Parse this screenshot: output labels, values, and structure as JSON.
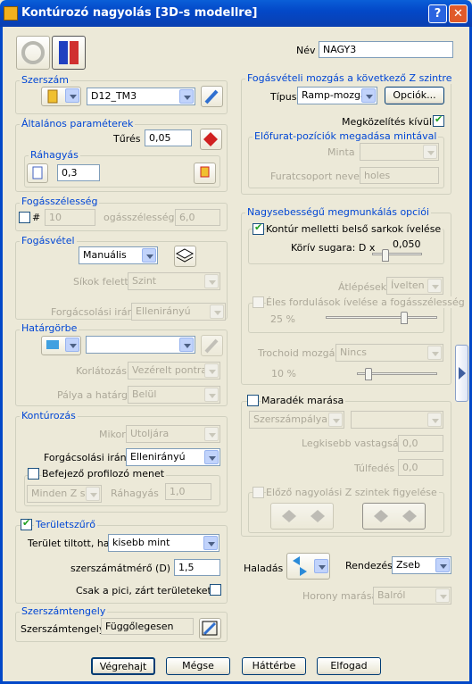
{
  "window": {
    "title": "Kontúrozó nagyolás [3D-s modellre]",
    "help": "?",
    "close": "✕"
  },
  "nev": {
    "label": "Név",
    "value": "NAGY3"
  },
  "szerszam": {
    "legend": "Szerszám",
    "tool": "D12_TM3"
  },
  "altalanos": {
    "legend": "Általános paraméterek",
    "tures_label": "Tűrés",
    "tures": "0,05",
    "rahagyas_legend": "Ráhagyás",
    "rahagyas": "0,3"
  },
  "fogasszelesseg": {
    "legend": "Fogásszélesség",
    "hash": "#",
    "count": "10",
    "label": "ogásszélesség",
    "value": "6,0"
  },
  "fogasvetel": {
    "legend": "Fogásvétel",
    "mode": "Manuális",
    "sikok_label": "Síkok felett",
    "sikok": "Szint",
    "irany_label": "Forgácsolási irány",
    "irany": "Ellenirányú"
  },
  "hatargorbe": {
    "legend": "Határgörbe",
    "value": "",
    "korlatozas_label": "Korlátozás",
    "korlatozas": "Vezérelt pontra",
    "palya_label": "Pálya a határgörbén",
    "palya": "Belül"
  },
  "konturozas": {
    "legend": "Kontúrozás",
    "mikor_label": "Mikor",
    "mikor": "Utoljára",
    "irany_label": "Forgácsolási irány",
    "irany": "Ellenirányú",
    "befejezo": "Befejező profilozó menet",
    "minden": "Minden Z szin",
    "rahagyas_label": "Ráhagyás",
    "rahagyas": "1,0"
  },
  "teruletszuro": {
    "legend": "Területszűrő",
    "tiltott_label": "Terület tiltott, ha",
    "tiltott": "kisebb mint",
    "atmero_label": "szerszámátmérő (D) x",
    "atmero": "1,5",
    "csak": "Csak a pici, zárt területeket"
  },
  "szerszamtengely": {
    "legend": "Szerszámtengely",
    "label": "Szerszámtengely",
    "value": "Függőlegesen"
  },
  "fogasveteli": {
    "legend": "Fogásvételi mozgás a következő Z szintre",
    "tipus_label": "Típus",
    "tipus": "Ramp-mozgás",
    "opciok": "Opciók...",
    "megkozelites": "Megközelítés kívülről",
    "elofurat_legend": "Előfurat-pozíciók megadása mintával",
    "minta_label": "Minta",
    "minta": "",
    "furatcsoport_label": "Furatcsoport neve",
    "furatcsoport": "holes"
  },
  "nagysebessegu": {
    "legend": "Nagysebességű megmunkálás opciói",
    "kontur": "Kontúr melletti belső sarkok ívelése",
    "korív_label": "Körív sugara: D x",
    "koriv": "0,050",
    "atlepesek_label": "Átlépések",
    "atlepesek": "Ívelten",
    "eles": "Éles fordulások ívelése a fogásszélesség",
    "eles_pct": "25 %",
    "trochoid_label": "Trochoid mozgás",
    "trochoid": "Nincs",
    "trochoid_pct": "10 %"
  },
  "maradek": {
    "label": "Maradék marása",
    "tipus": "Szerszámpálya",
    "tipus2": "",
    "legkisebb_label": "Legkisebb vastagság",
    "legkisebb": "0,0",
    "tulfedes_label": "Túlfedés",
    "tulfedes": "0,0",
    "elozo": "Előző nagyolási Z szintek figyelése"
  },
  "haladas": {
    "label": "Haladás",
    "rendezes_label": "Rendezés",
    "rendezes": "Zseb",
    "horony_label": "Horony marása",
    "horony": "Balról"
  },
  "buttons": {
    "vegrehajt": "Végrehajt",
    "megse": "Mégse",
    "hatterbe": "Háttérbe",
    "elfogad": "Elfogad"
  },
  "colors": {
    "title": "#0348c8",
    "accent": "#0046d5",
    "bg": "#ece9d8"
  }
}
